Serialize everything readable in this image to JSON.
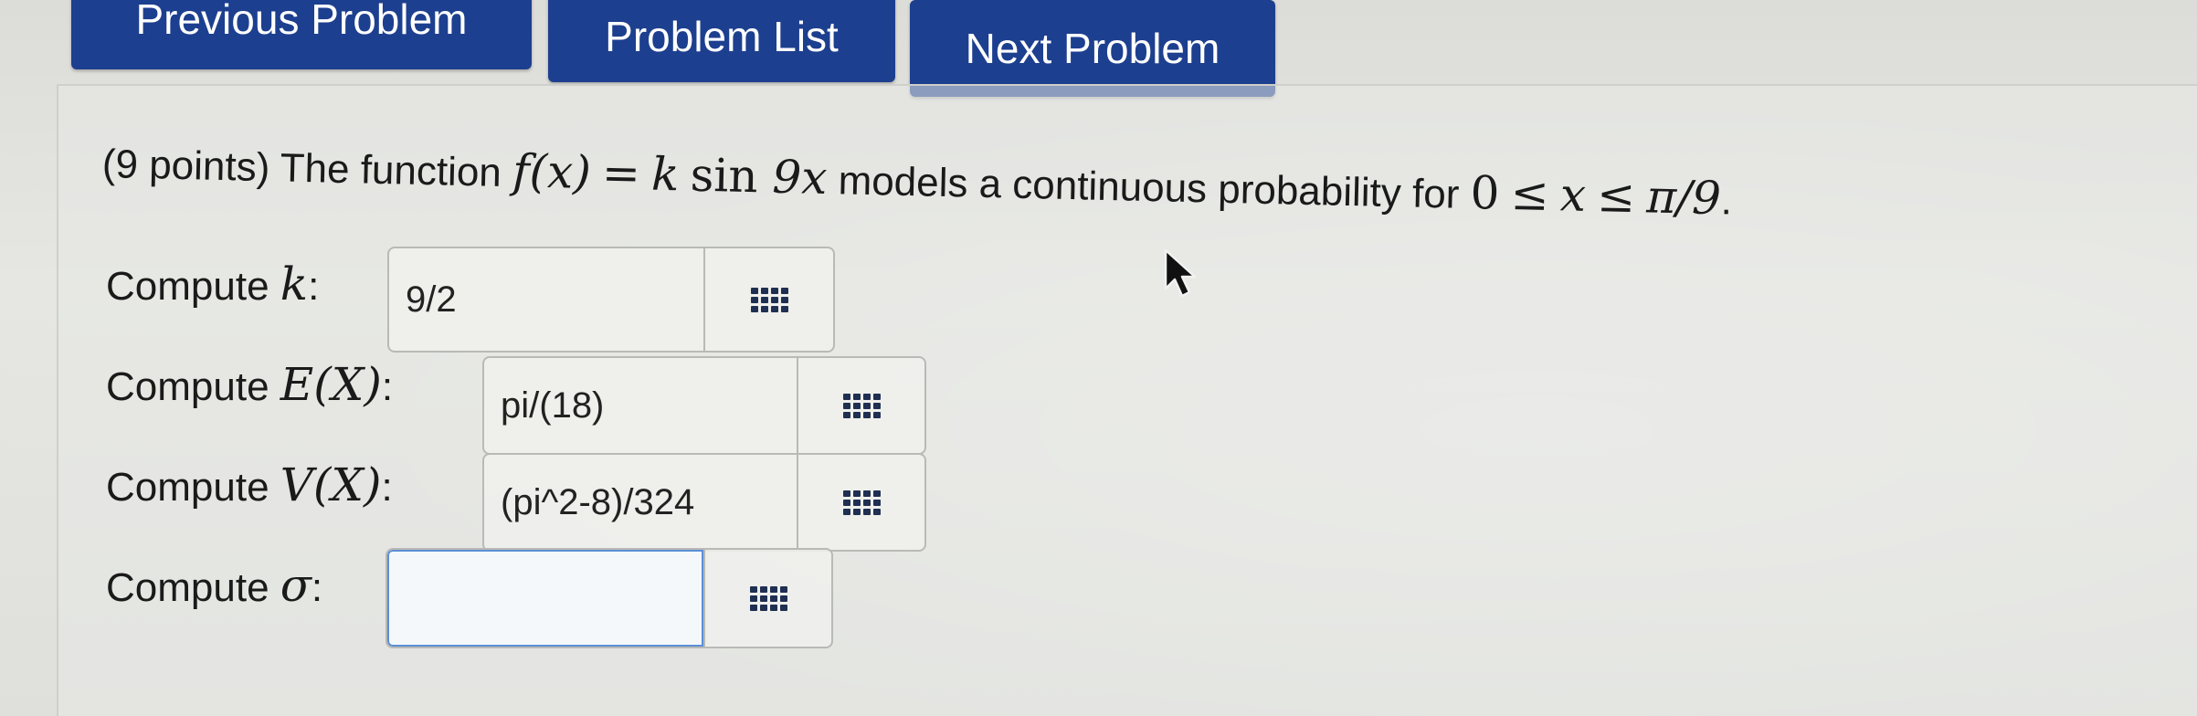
{
  "nav": {
    "previous_label": "Previous Problem",
    "list_label": "Problem List",
    "next_label": "Next Problem"
  },
  "problem": {
    "points": "(9 points)",
    "text_before_function": "The function",
    "function_lhs": "f(x)",
    "equals": "=",
    "function_k": "k",
    "function_sin": "sin",
    "function_arg": "9x",
    "text_middle": "models a continuous probability for",
    "domain_lower": "0",
    "domain_le1": "≤",
    "domain_var": "x",
    "domain_le2": "≤",
    "domain_upper": "π/9",
    "period": "."
  },
  "answers": [
    {
      "label_prefix": "Compute",
      "label_math": "k",
      "label_suffix": ":",
      "value": "9/2",
      "placeholder": ""
    },
    {
      "label_prefix": "Compute",
      "label_math": "E(X)",
      "label_suffix": ":",
      "value": "pi/(18)",
      "placeholder": ""
    },
    {
      "label_prefix": "Compute",
      "label_math": "V(X)",
      "label_suffix": ":",
      "value": "(pi^2-8)/324",
      "placeholder": ""
    },
    {
      "label_prefix": "Compute",
      "label_math": "σ",
      "label_suffix": ":",
      "value": "",
      "placeholder": ""
    }
  ],
  "icons": {
    "equation_editor": "grid-icon",
    "mouse_cursor": "arrow-cursor-icon"
  },
  "colors": {
    "nav_button": "#1d3f8f",
    "nav_text": "#ffffff",
    "active_input_border": "#5b8fd6"
  }
}
